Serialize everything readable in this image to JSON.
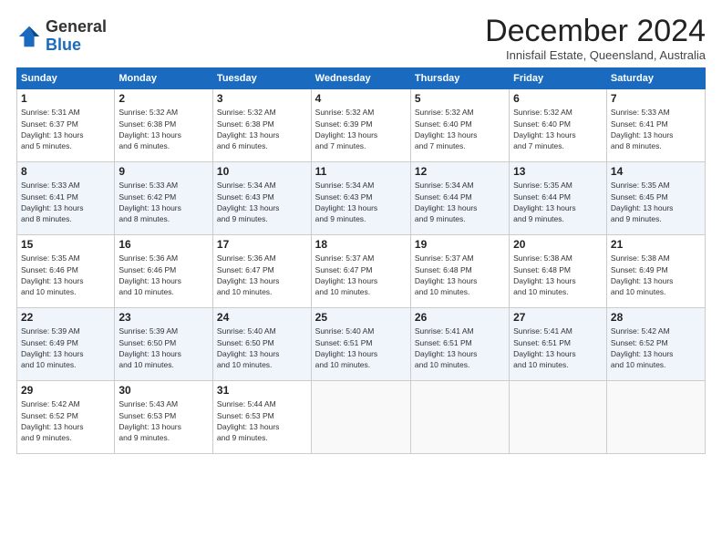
{
  "logo": {
    "general": "General",
    "blue": "Blue"
  },
  "header": {
    "month": "December 2024",
    "location": "Innisfail Estate, Queensland, Australia"
  },
  "weekdays": [
    "Sunday",
    "Monday",
    "Tuesday",
    "Wednesday",
    "Thursday",
    "Friday",
    "Saturday"
  ],
  "weeks": [
    [
      {
        "day": "1",
        "sunrise": "5:31 AM",
        "sunset": "6:37 PM",
        "daylight": "13 hours and 5 minutes."
      },
      {
        "day": "2",
        "sunrise": "5:32 AM",
        "sunset": "6:38 PM",
        "daylight": "13 hours and 6 minutes."
      },
      {
        "day": "3",
        "sunrise": "5:32 AM",
        "sunset": "6:38 PM",
        "daylight": "13 hours and 6 minutes."
      },
      {
        "day": "4",
        "sunrise": "5:32 AM",
        "sunset": "6:39 PM",
        "daylight": "13 hours and 7 minutes."
      },
      {
        "day": "5",
        "sunrise": "5:32 AM",
        "sunset": "6:40 PM",
        "daylight": "13 hours and 7 minutes."
      },
      {
        "day": "6",
        "sunrise": "5:32 AM",
        "sunset": "6:40 PM",
        "daylight": "13 hours and 7 minutes."
      },
      {
        "day": "7",
        "sunrise": "5:33 AM",
        "sunset": "6:41 PM",
        "daylight": "13 hours and 8 minutes."
      }
    ],
    [
      {
        "day": "8",
        "sunrise": "5:33 AM",
        "sunset": "6:41 PM",
        "daylight": "13 hours and 8 minutes."
      },
      {
        "day": "9",
        "sunrise": "5:33 AM",
        "sunset": "6:42 PM",
        "daylight": "13 hours and 8 minutes."
      },
      {
        "day": "10",
        "sunrise": "5:34 AM",
        "sunset": "6:43 PM",
        "daylight": "13 hours and 9 minutes."
      },
      {
        "day": "11",
        "sunrise": "5:34 AM",
        "sunset": "6:43 PM",
        "daylight": "13 hours and 9 minutes."
      },
      {
        "day": "12",
        "sunrise": "5:34 AM",
        "sunset": "6:44 PM",
        "daylight": "13 hours and 9 minutes."
      },
      {
        "day": "13",
        "sunrise": "5:35 AM",
        "sunset": "6:44 PM",
        "daylight": "13 hours and 9 minutes."
      },
      {
        "day": "14",
        "sunrise": "5:35 AM",
        "sunset": "6:45 PM",
        "daylight": "13 hours and 9 minutes."
      }
    ],
    [
      {
        "day": "15",
        "sunrise": "5:35 AM",
        "sunset": "6:46 PM",
        "daylight": "13 hours and 10 minutes."
      },
      {
        "day": "16",
        "sunrise": "5:36 AM",
        "sunset": "6:46 PM",
        "daylight": "13 hours and 10 minutes."
      },
      {
        "day": "17",
        "sunrise": "5:36 AM",
        "sunset": "6:47 PM",
        "daylight": "13 hours and 10 minutes."
      },
      {
        "day": "18",
        "sunrise": "5:37 AM",
        "sunset": "6:47 PM",
        "daylight": "13 hours and 10 minutes."
      },
      {
        "day": "19",
        "sunrise": "5:37 AM",
        "sunset": "6:48 PM",
        "daylight": "13 hours and 10 minutes."
      },
      {
        "day": "20",
        "sunrise": "5:38 AM",
        "sunset": "6:48 PM",
        "daylight": "13 hours and 10 minutes."
      },
      {
        "day": "21",
        "sunrise": "5:38 AM",
        "sunset": "6:49 PM",
        "daylight": "13 hours and 10 minutes."
      }
    ],
    [
      {
        "day": "22",
        "sunrise": "5:39 AM",
        "sunset": "6:49 PM",
        "daylight": "13 hours and 10 minutes."
      },
      {
        "day": "23",
        "sunrise": "5:39 AM",
        "sunset": "6:50 PM",
        "daylight": "13 hours and 10 minutes."
      },
      {
        "day": "24",
        "sunrise": "5:40 AM",
        "sunset": "6:50 PM",
        "daylight": "13 hours and 10 minutes."
      },
      {
        "day": "25",
        "sunrise": "5:40 AM",
        "sunset": "6:51 PM",
        "daylight": "13 hours and 10 minutes."
      },
      {
        "day": "26",
        "sunrise": "5:41 AM",
        "sunset": "6:51 PM",
        "daylight": "13 hours and 10 minutes."
      },
      {
        "day": "27",
        "sunrise": "5:41 AM",
        "sunset": "6:51 PM",
        "daylight": "13 hours and 10 minutes."
      },
      {
        "day": "28",
        "sunrise": "5:42 AM",
        "sunset": "6:52 PM",
        "daylight": "13 hours and 10 minutes."
      }
    ],
    [
      {
        "day": "29",
        "sunrise": "5:42 AM",
        "sunset": "6:52 PM",
        "daylight": "13 hours and 9 minutes."
      },
      {
        "day": "30",
        "sunrise": "5:43 AM",
        "sunset": "6:53 PM",
        "daylight": "13 hours and 9 minutes."
      },
      {
        "day": "31",
        "sunrise": "5:44 AM",
        "sunset": "6:53 PM",
        "daylight": "13 hours and 9 minutes."
      },
      null,
      null,
      null,
      null
    ]
  ]
}
